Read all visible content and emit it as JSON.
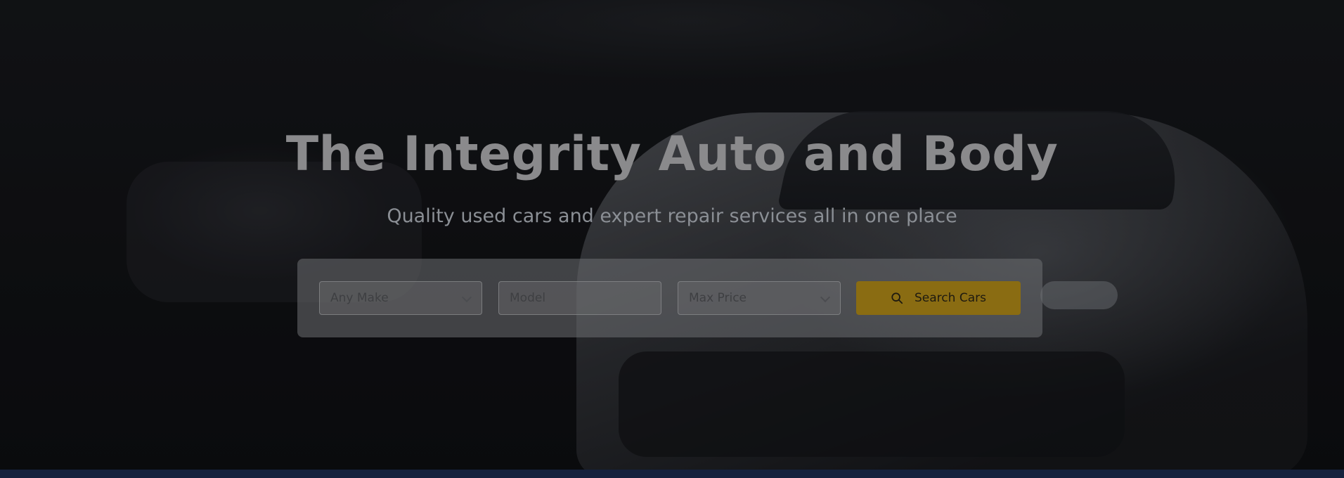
{
  "hero": {
    "title": "The Integrity Auto and Body",
    "subtitle": "Quality used cars and expert repair services all in one place"
  },
  "search": {
    "make_select": {
      "value": "Any Make",
      "icon": "chevron-down-icon"
    },
    "model_input": {
      "placeholder": "Model",
      "value": ""
    },
    "price_select": {
      "value": "Max Price",
      "icon": "chevron-down-icon"
    },
    "button": {
      "label": "Search Cars",
      "icon": "search-icon"
    }
  },
  "colors": {
    "accent": "#8a6c12",
    "footer_bar": "#15223d"
  }
}
